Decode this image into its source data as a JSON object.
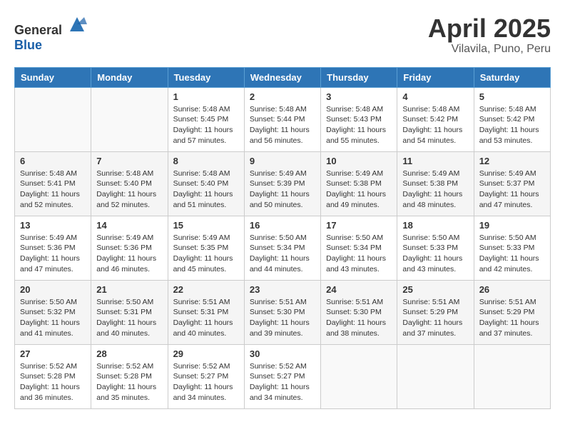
{
  "logo": {
    "general": "General",
    "blue": "Blue"
  },
  "header": {
    "title": "April 2025",
    "subtitle": "Vilavila, Puno, Peru"
  },
  "weekdays": [
    "Sunday",
    "Monday",
    "Tuesday",
    "Wednesday",
    "Thursday",
    "Friday",
    "Saturday"
  ],
  "weeks": [
    [
      {
        "day": "",
        "sunrise": "",
        "sunset": "",
        "daylight": ""
      },
      {
        "day": "",
        "sunrise": "",
        "sunset": "",
        "daylight": ""
      },
      {
        "day": "1",
        "sunrise": "Sunrise: 5:48 AM",
        "sunset": "Sunset: 5:45 PM",
        "daylight": "Daylight: 11 hours and 57 minutes."
      },
      {
        "day": "2",
        "sunrise": "Sunrise: 5:48 AM",
        "sunset": "Sunset: 5:44 PM",
        "daylight": "Daylight: 11 hours and 56 minutes."
      },
      {
        "day": "3",
        "sunrise": "Sunrise: 5:48 AM",
        "sunset": "Sunset: 5:43 PM",
        "daylight": "Daylight: 11 hours and 55 minutes."
      },
      {
        "day": "4",
        "sunrise": "Sunrise: 5:48 AM",
        "sunset": "Sunset: 5:42 PM",
        "daylight": "Daylight: 11 hours and 54 minutes."
      },
      {
        "day": "5",
        "sunrise": "Sunrise: 5:48 AM",
        "sunset": "Sunset: 5:42 PM",
        "daylight": "Daylight: 11 hours and 53 minutes."
      }
    ],
    [
      {
        "day": "6",
        "sunrise": "Sunrise: 5:48 AM",
        "sunset": "Sunset: 5:41 PM",
        "daylight": "Daylight: 11 hours and 52 minutes."
      },
      {
        "day": "7",
        "sunrise": "Sunrise: 5:48 AM",
        "sunset": "Sunset: 5:40 PM",
        "daylight": "Daylight: 11 hours and 52 minutes."
      },
      {
        "day": "8",
        "sunrise": "Sunrise: 5:48 AM",
        "sunset": "Sunset: 5:40 PM",
        "daylight": "Daylight: 11 hours and 51 minutes."
      },
      {
        "day": "9",
        "sunrise": "Sunrise: 5:49 AM",
        "sunset": "Sunset: 5:39 PM",
        "daylight": "Daylight: 11 hours and 50 minutes."
      },
      {
        "day": "10",
        "sunrise": "Sunrise: 5:49 AM",
        "sunset": "Sunset: 5:38 PM",
        "daylight": "Daylight: 11 hours and 49 minutes."
      },
      {
        "day": "11",
        "sunrise": "Sunrise: 5:49 AM",
        "sunset": "Sunset: 5:38 PM",
        "daylight": "Daylight: 11 hours and 48 minutes."
      },
      {
        "day": "12",
        "sunrise": "Sunrise: 5:49 AM",
        "sunset": "Sunset: 5:37 PM",
        "daylight": "Daylight: 11 hours and 47 minutes."
      }
    ],
    [
      {
        "day": "13",
        "sunrise": "Sunrise: 5:49 AM",
        "sunset": "Sunset: 5:36 PM",
        "daylight": "Daylight: 11 hours and 47 minutes."
      },
      {
        "day": "14",
        "sunrise": "Sunrise: 5:49 AM",
        "sunset": "Sunset: 5:36 PM",
        "daylight": "Daylight: 11 hours and 46 minutes."
      },
      {
        "day": "15",
        "sunrise": "Sunrise: 5:49 AM",
        "sunset": "Sunset: 5:35 PM",
        "daylight": "Daylight: 11 hours and 45 minutes."
      },
      {
        "day": "16",
        "sunrise": "Sunrise: 5:50 AM",
        "sunset": "Sunset: 5:34 PM",
        "daylight": "Daylight: 11 hours and 44 minutes."
      },
      {
        "day": "17",
        "sunrise": "Sunrise: 5:50 AM",
        "sunset": "Sunset: 5:34 PM",
        "daylight": "Daylight: 11 hours and 43 minutes."
      },
      {
        "day": "18",
        "sunrise": "Sunrise: 5:50 AM",
        "sunset": "Sunset: 5:33 PM",
        "daylight": "Daylight: 11 hours and 43 minutes."
      },
      {
        "day": "19",
        "sunrise": "Sunrise: 5:50 AM",
        "sunset": "Sunset: 5:33 PM",
        "daylight": "Daylight: 11 hours and 42 minutes."
      }
    ],
    [
      {
        "day": "20",
        "sunrise": "Sunrise: 5:50 AM",
        "sunset": "Sunset: 5:32 PM",
        "daylight": "Daylight: 11 hours and 41 minutes."
      },
      {
        "day": "21",
        "sunrise": "Sunrise: 5:50 AM",
        "sunset": "Sunset: 5:31 PM",
        "daylight": "Daylight: 11 hours and 40 minutes."
      },
      {
        "day": "22",
        "sunrise": "Sunrise: 5:51 AM",
        "sunset": "Sunset: 5:31 PM",
        "daylight": "Daylight: 11 hours and 40 minutes."
      },
      {
        "day": "23",
        "sunrise": "Sunrise: 5:51 AM",
        "sunset": "Sunset: 5:30 PM",
        "daylight": "Daylight: 11 hours and 39 minutes."
      },
      {
        "day": "24",
        "sunrise": "Sunrise: 5:51 AM",
        "sunset": "Sunset: 5:30 PM",
        "daylight": "Daylight: 11 hours and 38 minutes."
      },
      {
        "day": "25",
        "sunrise": "Sunrise: 5:51 AM",
        "sunset": "Sunset: 5:29 PM",
        "daylight": "Daylight: 11 hours and 37 minutes."
      },
      {
        "day": "26",
        "sunrise": "Sunrise: 5:51 AM",
        "sunset": "Sunset: 5:29 PM",
        "daylight": "Daylight: 11 hours and 37 minutes."
      }
    ],
    [
      {
        "day": "27",
        "sunrise": "Sunrise: 5:52 AM",
        "sunset": "Sunset: 5:28 PM",
        "daylight": "Daylight: 11 hours and 36 minutes."
      },
      {
        "day": "28",
        "sunrise": "Sunrise: 5:52 AM",
        "sunset": "Sunset: 5:28 PM",
        "daylight": "Daylight: 11 hours and 35 minutes."
      },
      {
        "day": "29",
        "sunrise": "Sunrise: 5:52 AM",
        "sunset": "Sunset: 5:27 PM",
        "daylight": "Daylight: 11 hours and 34 minutes."
      },
      {
        "day": "30",
        "sunrise": "Sunrise: 5:52 AM",
        "sunset": "Sunset: 5:27 PM",
        "daylight": "Daylight: 11 hours and 34 minutes."
      },
      {
        "day": "",
        "sunrise": "",
        "sunset": "",
        "daylight": ""
      },
      {
        "day": "",
        "sunrise": "",
        "sunset": "",
        "daylight": ""
      },
      {
        "day": "",
        "sunrise": "",
        "sunset": "",
        "daylight": ""
      }
    ]
  ]
}
